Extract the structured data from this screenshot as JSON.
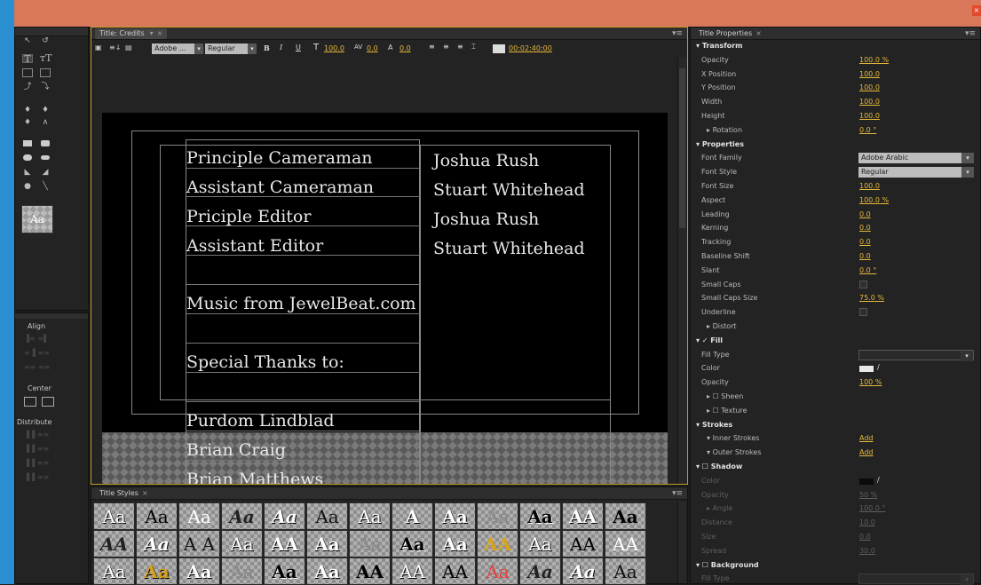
{
  "window": {
    "close_label": "×"
  },
  "tools_panel": {
    "align": {
      "title": "Align"
    },
    "center": {
      "title": "Center"
    },
    "distribute": {
      "title": "Distribute"
    },
    "style_sample": "Aa"
  },
  "title_panel": {
    "tab_label": "Title: Credits",
    "toolbar": {
      "font_family": "Adobe ...",
      "font_style": "Regular",
      "bold": "B",
      "italic": "I",
      "underline": "U",
      "font_size_icon": "T",
      "font_size": "100.0",
      "kerning_icon": "AV",
      "kerning": "0.0",
      "baseline_icon": "A",
      "leading": "0.0",
      "timecode": "00:02:40:00"
    },
    "credits": {
      "roles": [
        "Principle Cameraman",
        "Assistant Cameraman",
        "Priciple Editor",
        "Assistant Editor",
        "",
        "Music from JewelBeat.com",
        "",
        "Special Thanks to:",
        "",
        "Purdom Lindblad",
        "Brian Craig",
        "Brian Matthews"
      ],
      "names": [
        "Joshua Rush",
        "Stuart Whitehead",
        "Joshua Rush",
        "Stuart Whitehead"
      ]
    }
  },
  "styles_panel": {
    "tab_label": "Title Styles",
    "samples": [
      [
        "Aa",
        "Aa",
        "Aa",
        "Aa",
        "Aa",
        "Aa",
        "Aa",
        "A",
        "Aa",
        "Aa",
        "Aa",
        "AA",
        "Aa"
      ],
      [
        "AA",
        "Aa",
        "A A",
        "Aa",
        "AA",
        "Aa",
        "Aa",
        "Aa",
        "Aa",
        "AA",
        "Aa",
        "AA",
        "AA"
      ],
      [
        "Aa",
        "Aa",
        "Aa",
        "Aa",
        "Aa",
        "Aa",
        "AA",
        "AA",
        "AA",
        "Aa",
        "Aa",
        "Aa",
        "Aa"
      ]
    ]
  },
  "properties_panel": {
    "tab_label": "Title Properties",
    "transform": {
      "header": "Transform",
      "opacity_label": "Opacity",
      "opacity": "100.0 %",
      "xpos_label": "X Position",
      "xpos": "100.0",
      "ypos_label": "Y Position",
      "ypos": "100.0",
      "width_label": "Width",
      "width": "100.0",
      "height_label": "Height",
      "height": "100.0",
      "rotation_label": "Rotation",
      "rotation": "0.0 °"
    },
    "properties": {
      "header": "Properties",
      "font_family_label": "Font Family",
      "font_family": "Adobe Arabic",
      "font_style_label": "Font Style",
      "font_style": "Regular",
      "font_size_label": "Font Size",
      "font_size": "100.0",
      "aspect_label": "Aspect",
      "aspect": "100.0 %",
      "leading_label": "Leading",
      "leading": "0.0",
      "kerning_label": "Kerning",
      "kerning": "0.0",
      "tracking_label": "Tracking",
      "tracking": "0.0",
      "baseline_label": "Baseline Shift",
      "baseline": "0.0",
      "slant_label": "Slant",
      "slant": "0.0 °",
      "smallcaps_label": "Small Caps",
      "smallcaps_size_label": "Small Caps Size",
      "smallcaps_size": "75.0 %",
      "underline_label": "Underline",
      "distort_label": "Distort"
    },
    "fill": {
      "header": "Fill",
      "fill_type_label": "Fill Type",
      "color_label": "Color",
      "color": "#e8e8e8",
      "opacity_label": "Opacity",
      "opacity": "100 %",
      "sheen_label": "Sheen",
      "texture_label": "Texture"
    },
    "strokes": {
      "header": "Strokes",
      "inner_label": "Inner Strokes",
      "inner_action": "Add",
      "outer_label": "Outer Strokes",
      "outer_action": "Add"
    },
    "shadow": {
      "header": "Shadow",
      "color_label": "Color",
      "color": "#0a0a0a",
      "opacity_label": "Opacity",
      "opacity": "50 %",
      "angle_label": "Angle",
      "angle": "100.0 °",
      "distance_label": "Distance",
      "distance": "10.0",
      "size_label": "Size",
      "size": "0.0",
      "spread_label": "Spread",
      "spread": "30.0"
    },
    "background": {
      "header": "Background",
      "fill_type_label": "Fill Type"
    }
  }
}
